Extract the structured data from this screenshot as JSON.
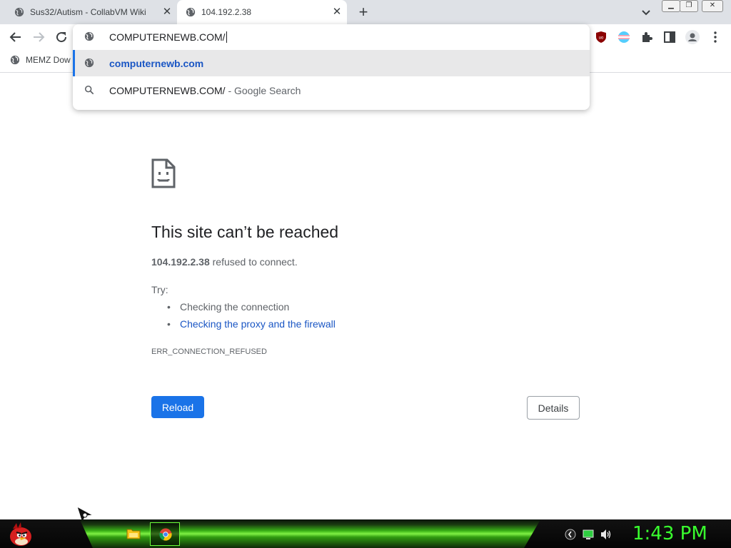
{
  "tabs": [
    {
      "title": "Sus32/Autism - CollabVM Wiki",
      "active": false
    },
    {
      "title": "104.192.2.38",
      "active": true
    }
  ],
  "omnibox": {
    "input_value": "COMPUTERNEWB.COM/",
    "suggestions": [
      {
        "icon": "globe-icon",
        "text": "computernewb.com"
      },
      {
        "icon": "search-icon",
        "query": "COMPUTERNEWB.COM/",
        "suffix": " - Google Search"
      }
    ]
  },
  "bookmarks": [
    {
      "label": "MEMZ Dow"
    }
  ],
  "error_page": {
    "title": "This site can’t be reached",
    "host": "104.192.2.38",
    "message": " refused to connect.",
    "try_label": "Try:",
    "suggestions": [
      "Checking the connection",
      "Checking the proxy and the firewall"
    ],
    "code": "ERR_CONNECTION_REFUSED",
    "reload_label": "Reload",
    "details_label": "Details"
  },
  "taskbar": {
    "clock": "1:43 PM"
  },
  "colors": {
    "accent": "#1a73e8",
    "link": "#1a56c4",
    "clock": "#39ff2e"
  }
}
